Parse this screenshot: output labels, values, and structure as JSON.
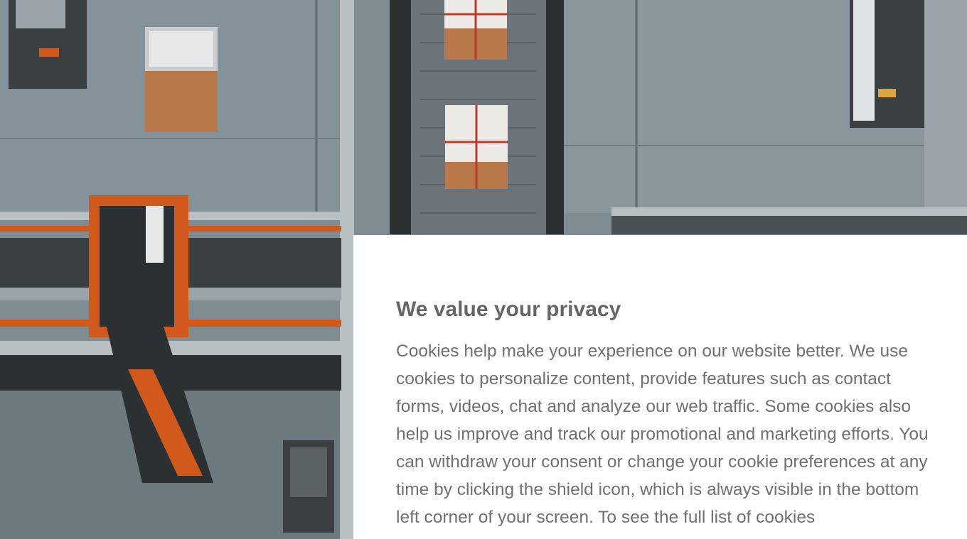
{
  "consent_dialog": {
    "title": "We value your privacy",
    "body": "Cookies help make your experience on our website better. We use cookies to personalize content, provide features such as contact forms, videos, chat and analyze our web traffic. Some cookies also help us improve and track our promotional and marketing efforts. You can withdraw your consent or change your cookie preferences at any time by clicking the shield icon, which is always visible in the bottom left corner of your screen. To see the full list of cookies"
  },
  "hero_image": {
    "subject": "warehouse-conveyor-aerial",
    "colors": {
      "floor": "#7d8a8f",
      "machinery_accent": "#d2591c",
      "box": "#b9784a",
      "dark": "#2b3033"
    }
  }
}
